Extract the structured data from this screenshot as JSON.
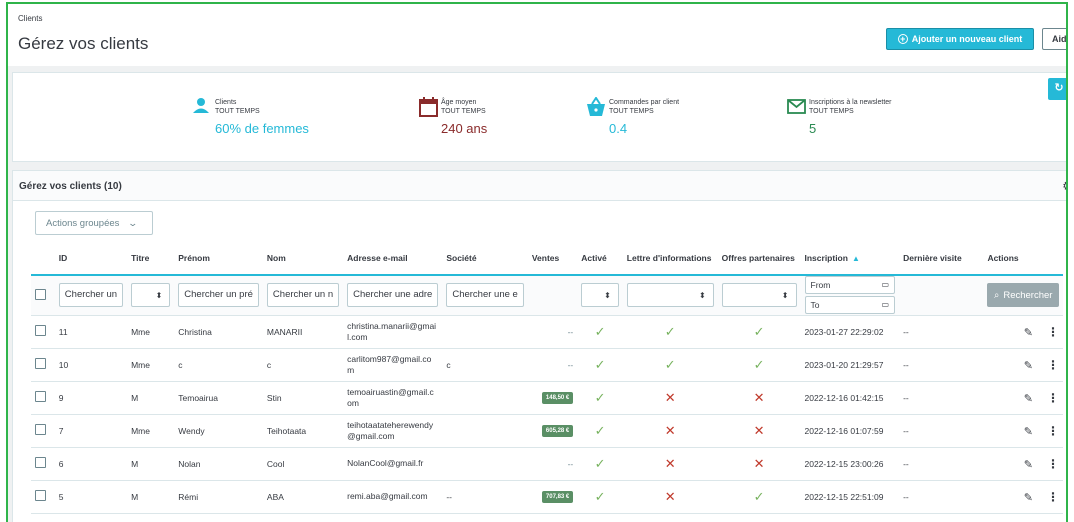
{
  "header": {
    "breadcrumb": "Clients",
    "title": "Gérez vos clients",
    "add_button": "Ajouter un nouveau client",
    "help_button": "Aide"
  },
  "kpis": [
    {
      "icon": "person-icon",
      "label": "Clients",
      "period": "TOUT TEMPS",
      "value": "60% de femmes",
      "color": "#25b9d7"
    },
    {
      "icon": "calendar-icon",
      "label": "Âge moyen",
      "period": "TOUT TEMPS",
      "value": "240 ans",
      "color": "#8a2b2b"
    },
    {
      "icon": "basket-icon",
      "label": "Commandes par client",
      "period": "TOUT TEMPS",
      "value": "0.4",
      "color": "#25b9d7"
    },
    {
      "icon": "envelope-icon",
      "label": "Inscriptions à la newsletter",
      "period": "TOUT TEMPS",
      "value": "5",
      "color": "#2a8a52"
    }
  ],
  "grid": {
    "title": "Gérez vos clients (10)",
    "bulk_actions": "Actions groupées",
    "columns": {
      "id": "ID",
      "title": "Titre",
      "first_name": "Prénom",
      "last_name": "Nom",
      "email": "Adresse e-mail",
      "company": "Société",
      "sales": "Ventes",
      "active": "Activé",
      "newsletter": "Lettre d'informations",
      "optin": "Offres partenaires",
      "date_add": "Inscription",
      "last_visit": "Dernière visite",
      "actions": "Actions"
    },
    "filters": {
      "id": "Chercher un",
      "first_name": "Chercher un pré",
      "last_name": "Chercher un n",
      "email": "Chercher une adre",
      "company": "Chercher une e",
      "date_from": "From",
      "date_to": "To",
      "search_button": "Rechercher"
    },
    "rows": [
      {
        "id": "11",
        "title": "Mme",
        "first_name": "Christina",
        "last_name": "MANARII",
        "email": "christina.manarii@gmail.com",
        "company": "",
        "sales": "--",
        "active": "yes",
        "newsletter": "yes",
        "optin": "yes",
        "date_add": "2023-01-27 22:29:02",
        "last_visit": "--"
      },
      {
        "id": "10",
        "title": "Mme",
        "first_name": "c",
        "last_name": "c",
        "email": "carlitom987@gmail.com",
        "company": "c",
        "sales": "--",
        "active": "yes",
        "newsletter": "yes",
        "optin": "yes",
        "date_add": "2023-01-20 21:29:57",
        "last_visit": "--"
      },
      {
        "id": "9",
        "title": "M",
        "first_name": "Temoairua",
        "last_name": "Stin",
        "email": "temoairuastin@gmail.com",
        "company": "",
        "sales": "148,50 €",
        "active": "yes",
        "newsletter": "no",
        "optin": "no",
        "date_add": "2022-12-16 01:42:15",
        "last_visit": "--"
      },
      {
        "id": "7",
        "title": "Mme",
        "first_name": "Wendy",
        "last_name": "Teihotaata",
        "email": "teihotaatateherewendy@gmail.com",
        "company": "",
        "sales": "605,28 €",
        "active": "yes",
        "newsletter": "no",
        "optin": "no",
        "date_add": "2022-12-16 01:07:59",
        "last_visit": "--"
      },
      {
        "id": "6",
        "title": "M",
        "first_name": "Nolan",
        "last_name": "Cool",
        "email": "NolanCool@gmail.fr",
        "company": "",
        "sales": "--",
        "active": "yes",
        "newsletter": "no",
        "optin": "no",
        "date_add": "2022-12-15 23:00:26",
        "last_visit": "--"
      },
      {
        "id": "5",
        "title": "M",
        "first_name": "Rémi",
        "last_name": "ABA",
        "email": "remi.aba@gmail.com",
        "company": "--",
        "sales": "707,83 €",
        "active": "yes",
        "newsletter": "no",
        "optin": "yes",
        "date_add": "2022-12-15 22:51:09",
        "last_visit": "--"
      }
    ]
  }
}
